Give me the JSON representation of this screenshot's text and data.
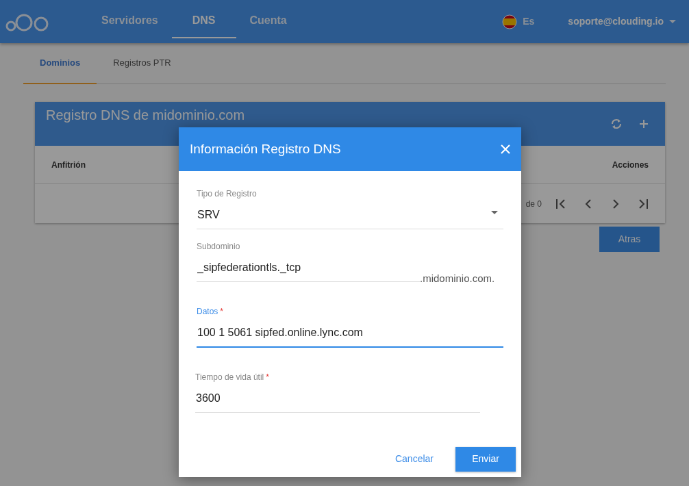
{
  "nav": {
    "items": [
      {
        "label": "Servidores",
        "selected": false
      },
      {
        "label": "DNS",
        "selected": true
      },
      {
        "label": "Cuenta",
        "selected": false
      }
    ],
    "language": "Es",
    "user": "soporte@clouding.io"
  },
  "tabs": [
    {
      "label": "Dominios",
      "selected": true
    },
    {
      "label": "Registros PTR",
      "selected": false
    }
  ],
  "card": {
    "title": "Registro DNS de midominio.com",
    "columns": [
      "Anfitrión",
      "Acciones"
    ],
    "pagination": "de 0"
  },
  "back_button": "Atras",
  "dialog": {
    "title": "Información Registro DNS",
    "fields": [
      {
        "kind": "select",
        "label": "Tipo de Registro",
        "value": "SRV",
        "focused": false
      },
      {
        "kind": "suffix",
        "label": "Subdominio",
        "value": "_sipfederationtls._tcp",
        "suffix": ".midominio.com.",
        "focused": false
      },
      {
        "kind": "text",
        "label": "Datos",
        "value": "100 1 5061 sipfed.online.lync.com",
        "required_mark": "*",
        "focused": true
      },
      {
        "kind": "short",
        "label": "Tiempo de vida útil",
        "value": "3600",
        "required_mark": "*",
        "focused": false
      }
    ],
    "cancel": "Cancelar",
    "submit": "Enviar"
  }
}
